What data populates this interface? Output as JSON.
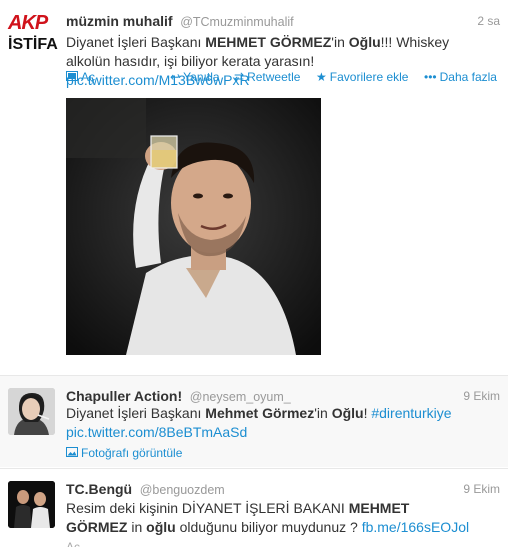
{
  "tweets": [
    {
      "avatar": {
        "line1": "AKP",
        "line2": "İSTİFA"
      },
      "name": "müzmin muhalif",
      "handle": "@TCmuzminmuhalif",
      "time": "2 sa",
      "text_parts": [
        "Diyanet İşleri Başkanı ",
        "MEHMET GÖRMEZ",
        "'in ",
        "Oğlu",
        "!!! Whiskey",
        "alkolün hasıdır, işi biliyor kerata yarasın! ",
        "pic.twitter.com/M13Bw6wPxR"
      ],
      "expand_label": "Aç",
      "actions": {
        "reply": "Yanıtla",
        "retweet": "Retweetle",
        "favorite": "Favorilere ekle",
        "more": "Daha fazla"
      }
    },
    {
      "name": "Chapuller Action!",
      "handle": "@neysem_oyum_",
      "time": "9 Ekim",
      "text_parts": [
        "Diyanet İşleri Başkanı ",
        "Mehmet Görmez",
        "'in ",
        "Oğlu",
        "! ",
        "#direnturkiye"
      ],
      "link": "pic.twitter.com/8BeBTmAaSd",
      "photo_label": "Fotoğrafı görüntüle"
    },
    {
      "name": "TC.Bengü",
      "handle": "@benguozdem",
      "time": "9 Ekim",
      "text_parts": [
        "Resim deki kişinin DİYANET İŞLERİ BAKANI ",
        "MEHMET",
        "GÖRMEZ",
        " in ",
        "oğlu",
        " olduğunu biliyor muydunuz ? ",
        "fb.me/166sEOJol"
      ],
      "expand_label": "Aç"
    }
  ],
  "colors": {
    "link": "#1c8ed1",
    "muted": "#999999",
    "akp_red": "#d0121b"
  },
  "icons": [
    "retweet-icon",
    "reply-icon",
    "star-icon",
    "more-dots-icon",
    "expand-card-icon",
    "photo-icon"
  ]
}
